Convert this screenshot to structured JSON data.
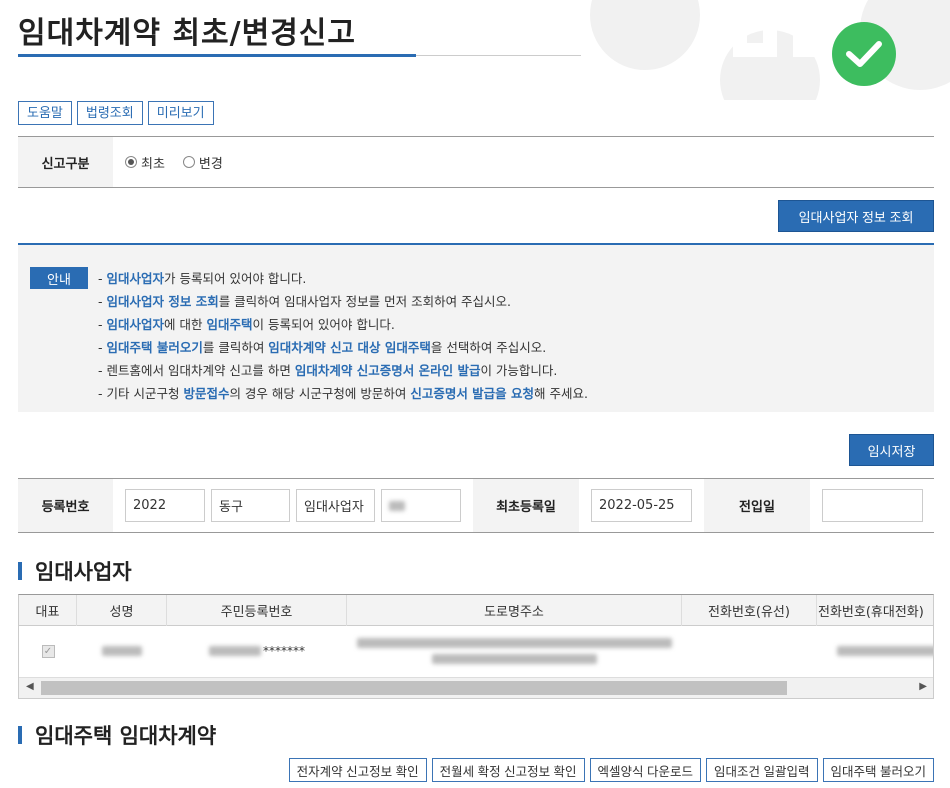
{
  "page": {
    "title": "임대차계약 최초/변경신고"
  },
  "top_buttons": [
    "도움말",
    "법령조회",
    "미리보기"
  ],
  "report_type": {
    "label": "신고구분",
    "options": [
      {
        "label": "최초",
        "selected": true
      },
      {
        "label": "변경",
        "selected": false
      }
    ]
  },
  "lessor_lookup_button": "임대사업자 정보 조회",
  "guide": {
    "tag": "안내",
    "lines": [
      [
        {
          "t": "- "
        },
        {
          "t": "임대사업자",
          "hl": true
        },
        {
          "t": "가 등록되어 있어야 합니다."
        }
      ],
      [
        {
          "t": "- "
        },
        {
          "t": "임대사업자 정보 조회",
          "hl": true
        },
        {
          "t": "를 클릭하여 임대사업자 정보를 먼저 조회하여 주십시오."
        }
      ],
      [
        {
          "t": "- "
        },
        {
          "t": "임대사업자",
          "hl": true
        },
        {
          "t": "에 대한 "
        },
        {
          "t": "임대주택",
          "hl": true
        },
        {
          "t": "이 등록되어 있어야 합니다."
        }
      ],
      [
        {
          "t": "- "
        },
        {
          "t": "임대주택 불러오기",
          "hl": true
        },
        {
          "t": "를 클릭하여 "
        },
        {
          "t": "임대차계약 신고 대상 임대주택",
          "hl": true
        },
        {
          "t": "을 선택하여 주십시오."
        }
      ],
      [
        {
          "t": "- 렌트홈에서 임대차계약 신고를 하면 "
        },
        {
          "t": "임대차계약 신고증명서 온라인 발급",
          "hl": true
        },
        {
          "t": "이 가능합니다."
        }
      ],
      [
        {
          "t": "- 기타 시군구청 "
        },
        {
          "t": "방문접수",
          "hl": true
        },
        {
          "t": "의 경우 해당 시군구청에 방문하여 "
        },
        {
          "t": "신고증명서 발급을 요청",
          "hl": true
        },
        {
          "t": "해 주세요."
        }
      ]
    ]
  },
  "save_button": "임시저장",
  "registration": {
    "label": "등록번호",
    "year": "2022",
    "district": "동구",
    "type": "임대사업자",
    "first_reg_label": "최초등록일",
    "first_reg_date": "2022-05-25",
    "move_in_label": "전입일",
    "move_in_value": ""
  },
  "lessor_section": {
    "title": "임대사업자",
    "columns": [
      "대표",
      "성명",
      "주민등록번호",
      "도로명주소",
      "전화번호(유선)",
      "전화번호(휴대전화)"
    ],
    "row": {
      "masked_id": "*******"
    }
  },
  "contract_section": {
    "title": "임대주택 임대차계약",
    "buttons": [
      "전자계약 신고정보 확인",
      "전월세 확정 신고정보 확인",
      "엑셀양식 다운로드",
      "임대조건 일괄입력",
      "임대주택 불러오기"
    ]
  },
  "colors": {
    "accent": "#2a6cb3",
    "check_green": "#3dbd5f"
  }
}
